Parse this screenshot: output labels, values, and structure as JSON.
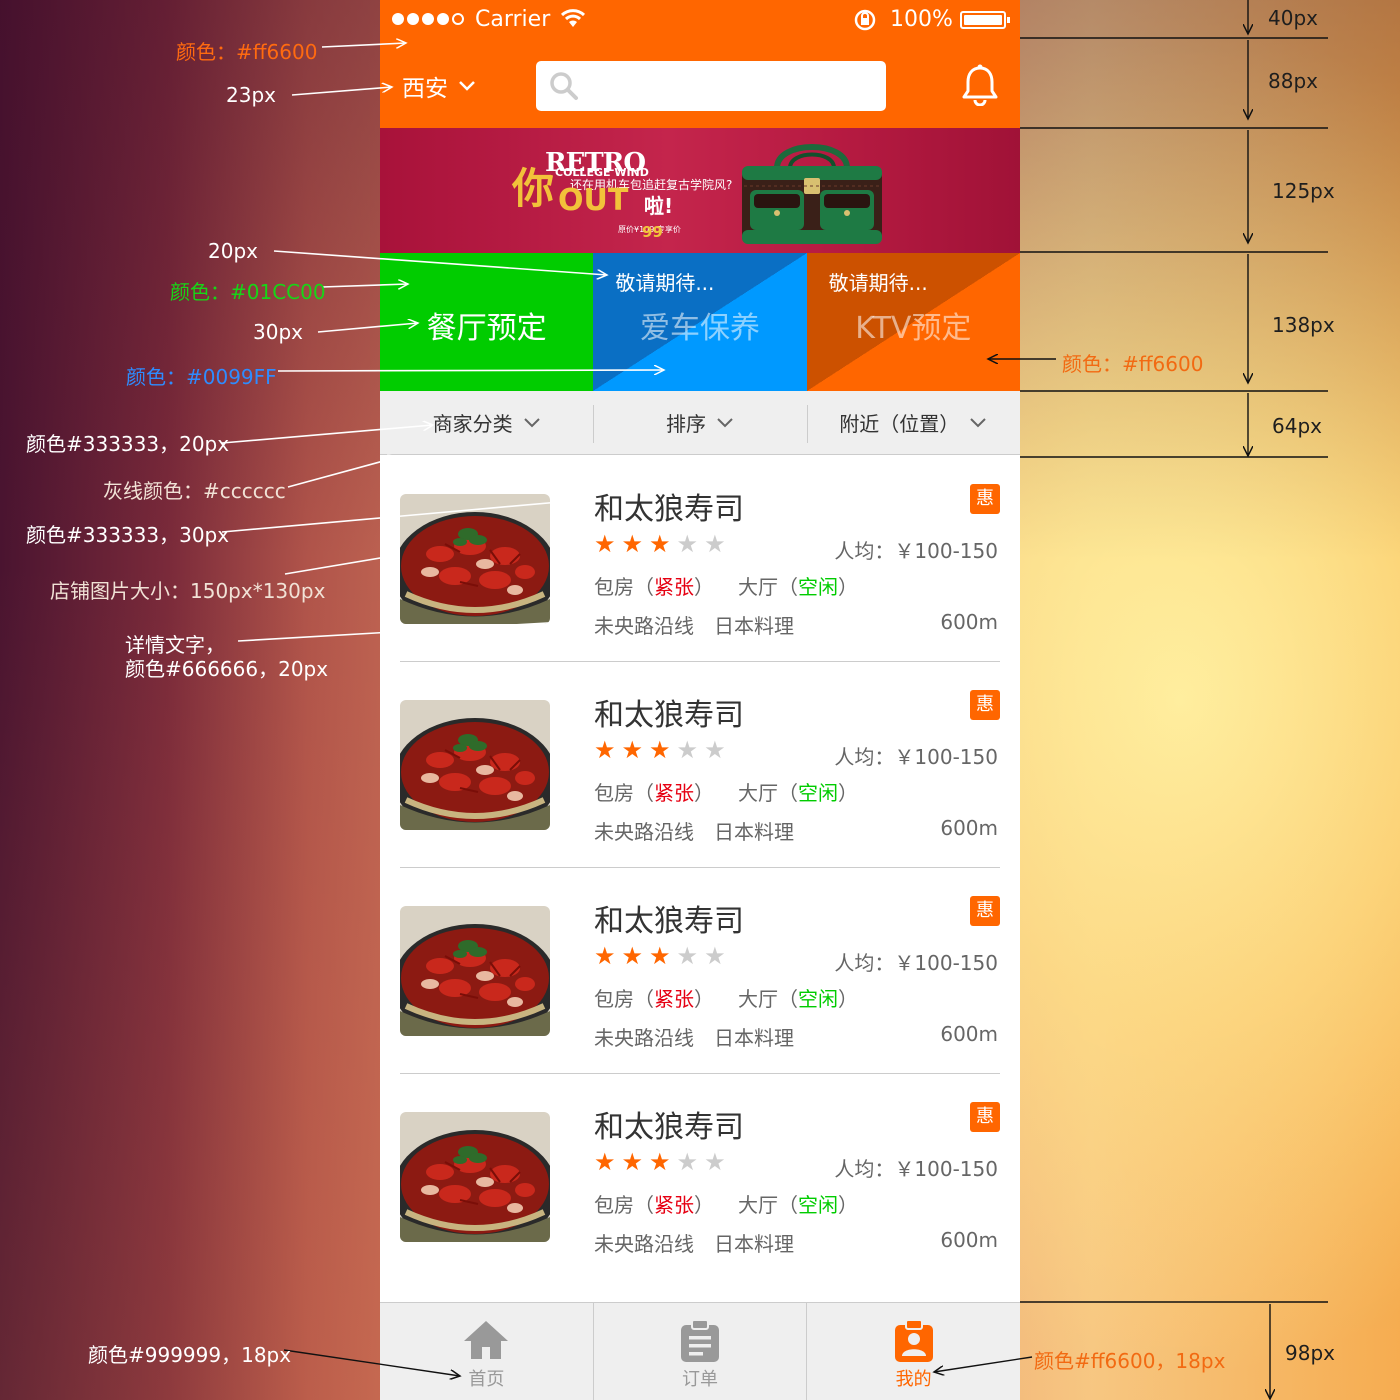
{
  "status_bar": {
    "carrier": "Carrier",
    "battery": "100%"
  },
  "header": {
    "city": "西安",
    "search_placeholder": ""
  },
  "banner": {
    "retro": "RETRO",
    "college": "COLLEGE WIND",
    "ni": "你",
    "subtitle": "还在用机车包追赶复古学院风?",
    "out": "OUT",
    "la": "啦!",
    "price_small": "原价¥109 专享价",
    "price": "99"
  },
  "tiles": [
    {
      "sub": "",
      "main": "餐厅预定"
    },
    {
      "sub": "敬请期待...",
      "main": "爱车保养"
    },
    {
      "sub": "敬请期待...",
      "main": "KTV预定"
    }
  ],
  "filters": [
    "商家分类",
    "排序",
    "附近（位置）"
  ],
  "listings": [
    {
      "name": "和太狼寿司",
      "badge": "惠",
      "rating": 3,
      "price": "人均：￥100-150",
      "room_label": "包房（",
      "room_status": "紧张",
      "room_close": "）",
      "hall_label": "大厅（",
      "hall_status": "空闲",
      "hall_close": "）",
      "location": "未央路沿线",
      "cuisine": "日本料理",
      "distance": "600m"
    },
    {
      "name": "和太狼寿司",
      "badge": "惠",
      "rating": 3,
      "price": "人均：￥100-150",
      "room_label": "包房（",
      "room_status": "紧张",
      "room_close": "）",
      "hall_label": "大厅（",
      "hall_status": "空闲",
      "hall_close": "）",
      "location": "未央路沿线",
      "cuisine": "日本料理",
      "distance": "600m"
    },
    {
      "name": "和太狼寿司",
      "badge": "惠",
      "rating": 3,
      "price": "人均：￥100-150",
      "room_label": "包房（",
      "room_status": "紧张",
      "room_close": "）",
      "hall_label": "大厅（",
      "hall_status": "空闲",
      "hall_close": "）",
      "location": "未央路沿线",
      "cuisine": "日本料理",
      "distance": "600m"
    },
    {
      "name": "和太狼寿司",
      "badge": "惠",
      "rating": 3,
      "price": "人均：￥100-150",
      "room_label": "包房（",
      "room_status": "紧张",
      "room_close": "）",
      "hall_label": "大厅（",
      "hall_status": "空闲",
      "hall_close": "）",
      "location": "未央路沿线",
      "cuisine": "日本料理",
      "distance": "600m"
    }
  ],
  "tabs": [
    {
      "label": "首页",
      "icon": "home-icon",
      "active": false
    },
    {
      "label": "订单",
      "icon": "clipboard-icon",
      "active": false
    },
    {
      "label": "我的",
      "icon": "profile-icon",
      "active": true
    }
  ],
  "annotations": {
    "color_header": "颜色：#ff6600",
    "city_size": "23px",
    "sub_size": "20px",
    "color_green": "颜色：#01CC00",
    "tile_size": "30px",
    "color_blue": "颜色：#0099FF",
    "color_orange_tile": "颜色：#ff6600",
    "filter_text": "颜色#333333，20px",
    "gray_line": "灰线颜色：#cccccc",
    "name_text": "颜色#333333，30px",
    "thumb_size": "店铺图片大小：150px*130px",
    "detail_line1": "详情文字，",
    "detail_line2": "颜色#666666，20px",
    "tab_gray": "颜色#999999，18px",
    "tab_orange": "颜色#ff6600，18px"
  },
  "dimensions": [
    "40px",
    "88px",
    "125px",
    "138px",
    "64px",
    "98px"
  ],
  "colors": {
    "primary": "#ff6600",
    "green": "#01CC00",
    "blue": "#0099FF",
    "text_dark": "#333333",
    "text_mid": "#666666",
    "text_light": "#999999",
    "divider": "#cccccc"
  }
}
